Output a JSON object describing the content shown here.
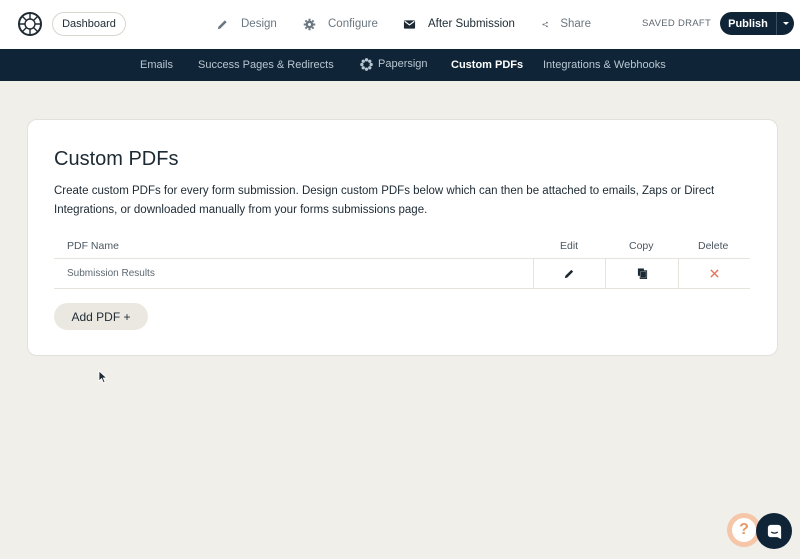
{
  "topbar": {
    "dashboard_label": "Dashboard",
    "nav": [
      {
        "label": "Design",
        "icon": "pencil-icon"
      },
      {
        "label": "Configure",
        "icon": "gear-icon"
      },
      {
        "label": "After Submission",
        "icon": "envelope-icon",
        "active": true
      },
      {
        "label": "Share",
        "icon": "share-icon"
      }
    ],
    "status": "SAVED DRAFT",
    "publish_label": "Publish"
  },
  "subnav": {
    "items": [
      {
        "label": "Emails"
      },
      {
        "label": "Success Pages & Redirects"
      },
      {
        "label": "Papersign",
        "icon": "papersign-icon"
      },
      {
        "label": "Custom PDFs",
        "active": true
      },
      {
        "label": "Integrations & Webhooks"
      }
    ]
  },
  "main": {
    "title": "Custom PDFs",
    "description": "Create custom PDFs for every form submission. Design custom PDFs below which can then be attached to emails, Zaps or Direct Integrations, or downloaded manually from your forms submissions page.",
    "table": {
      "columns": [
        "PDF Name",
        "Edit",
        "Copy",
        "Delete"
      ],
      "rows": [
        {
          "name": "Submission Results"
        }
      ]
    },
    "add_label": "Add PDF +"
  },
  "colors": {
    "navy": "#0f2537",
    "background": "#f1efea",
    "delete": "#e8735a",
    "help_accent": "#f5c6a8"
  }
}
